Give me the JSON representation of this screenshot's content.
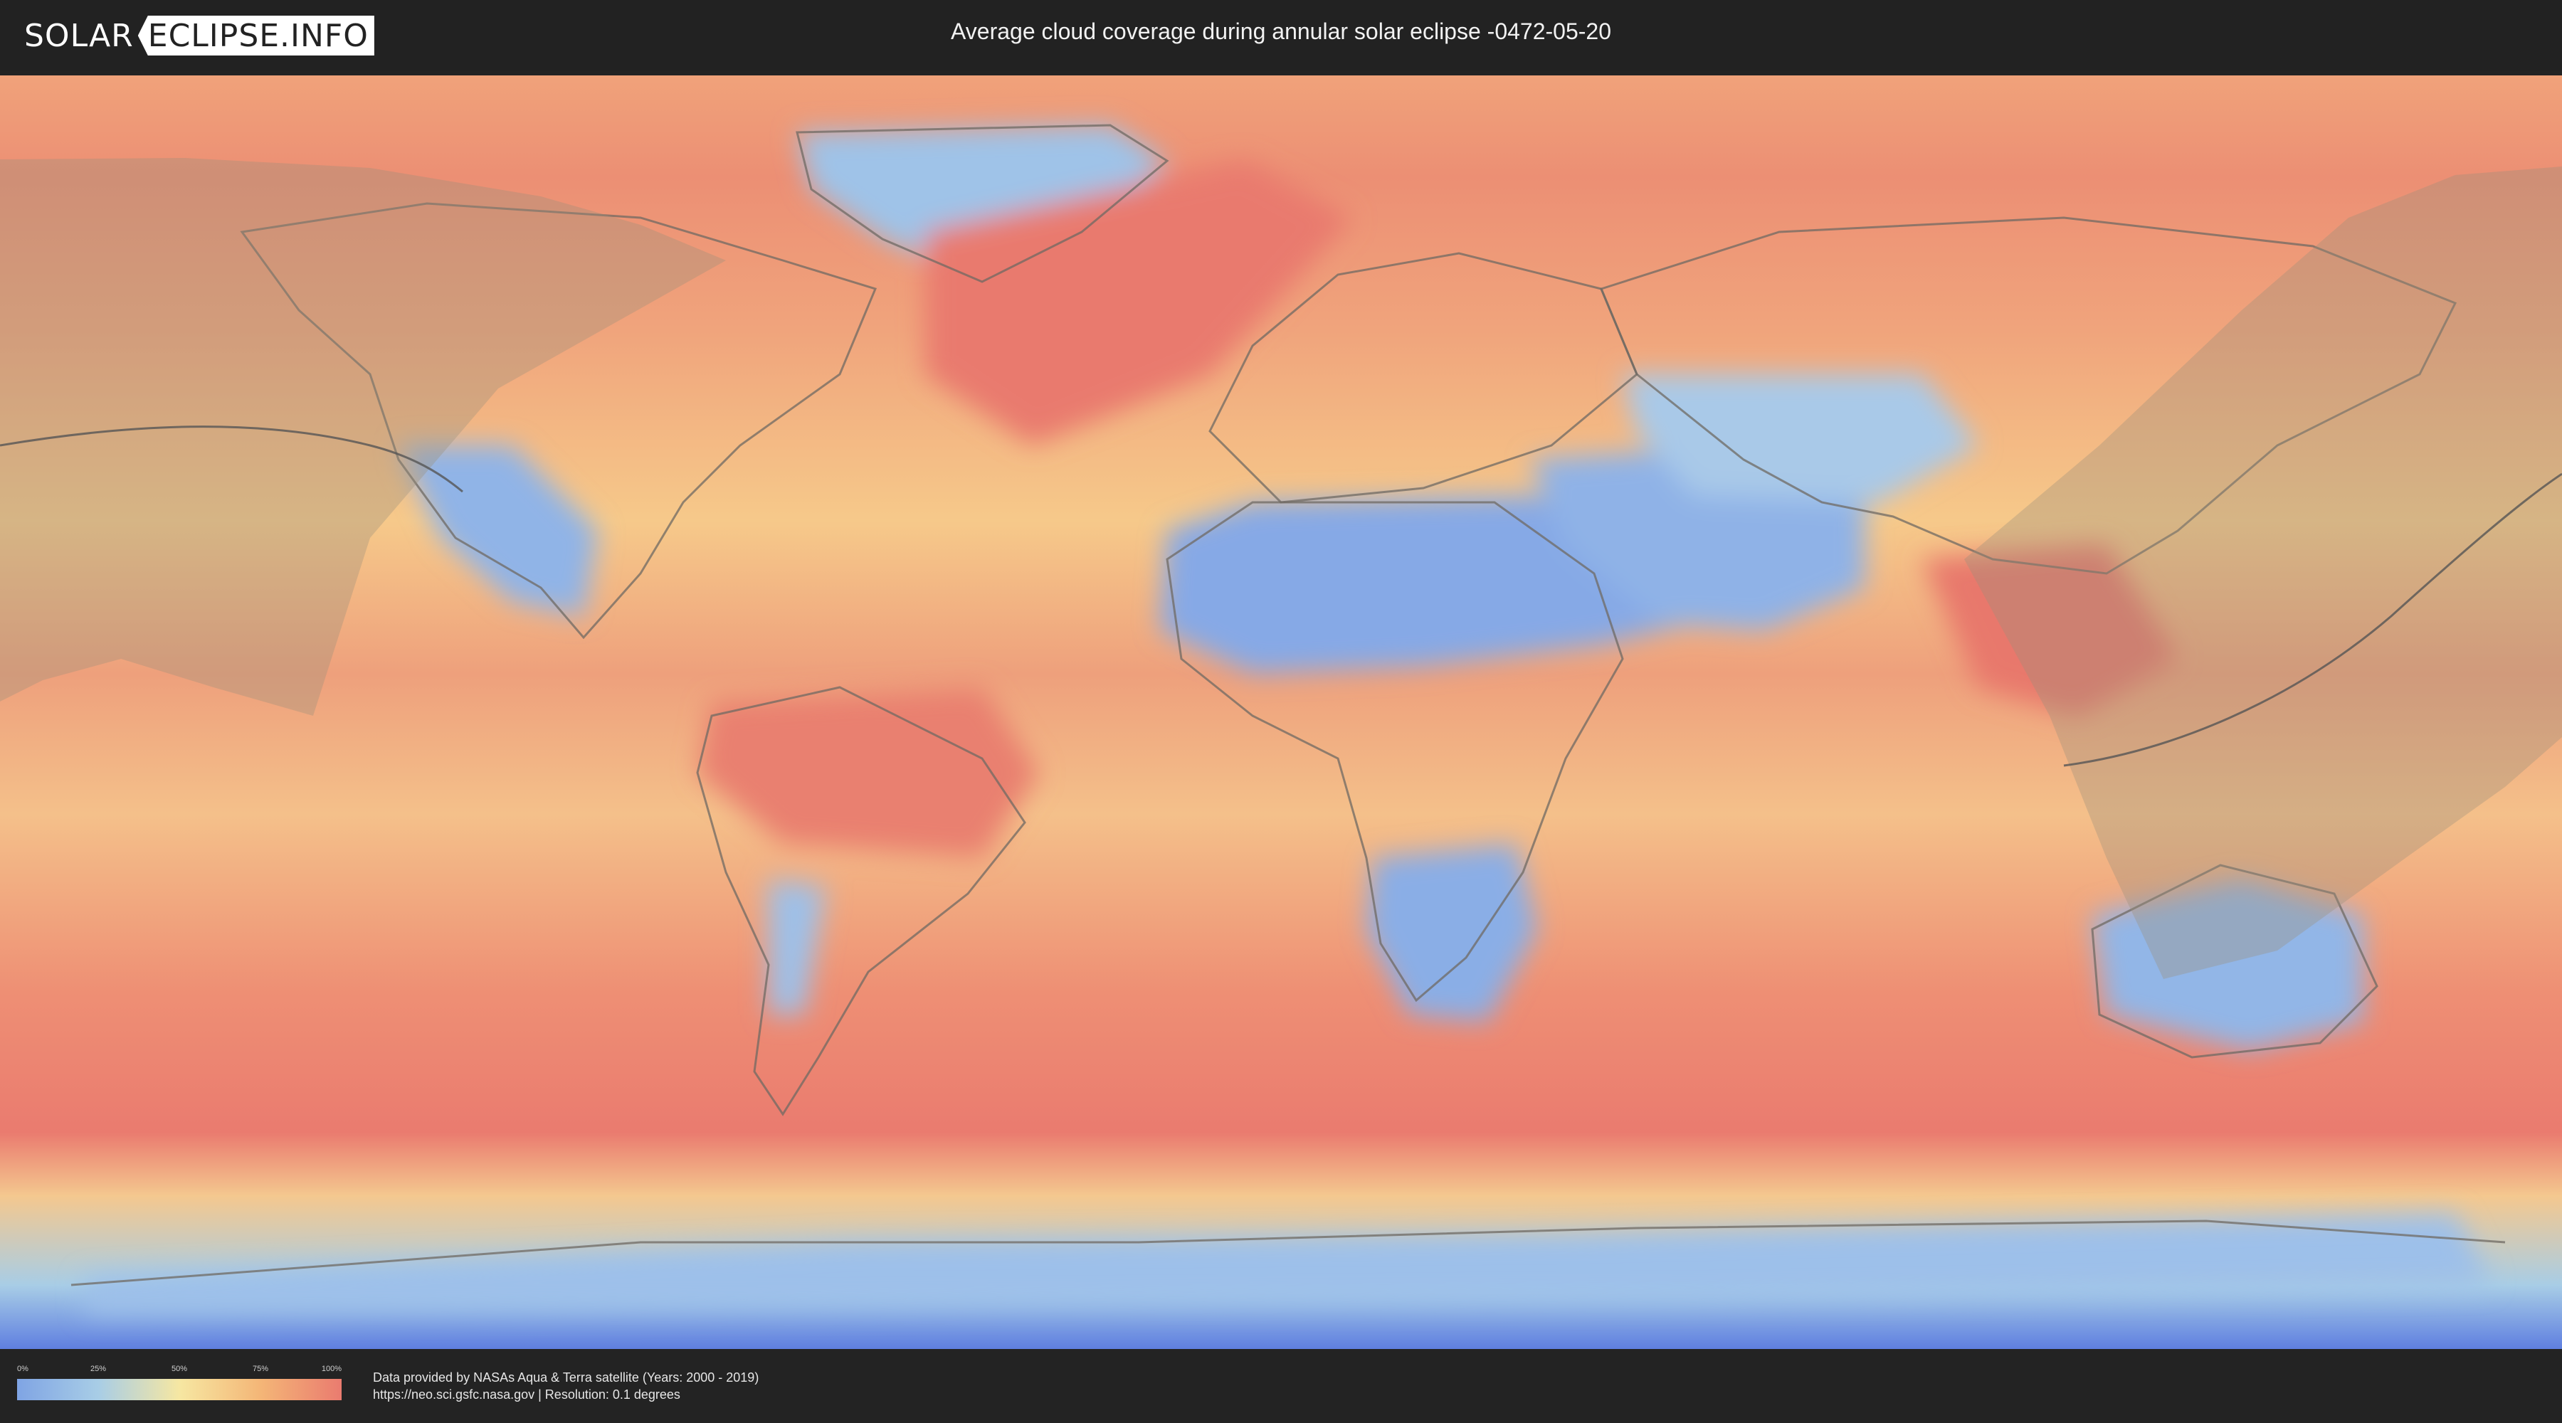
{
  "header": {
    "logo_left": "SOLAR",
    "logo_right": "ECLIPSE.INFO",
    "title": "Average cloud coverage during annular solar eclipse -0472-05-20"
  },
  "map": {
    "colors": {
      "cloudy": "#ea7b6f",
      "mostly_cloudy": "#f4b677",
      "partly_cloudy": "#f6e7a2",
      "mostly_clear": "#a8cde6",
      "clear": "#7fa4e4",
      "eclipse_overlay": "#9a8f7a",
      "eclipse_path": "#555555"
    }
  },
  "legend": {
    "ticks": [
      "0%",
      "25%",
      "50%",
      "75%",
      "100%"
    ]
  },
  "footer": {
    "credit_line1": "Data provided by NASAs Aqua & Terra satellite (Years: 2000 - 2019)",
    "credit_line2": "https://neo.sci.gsfc.nasa.gov | Resolution: 0.1 degrees"
  }
}
